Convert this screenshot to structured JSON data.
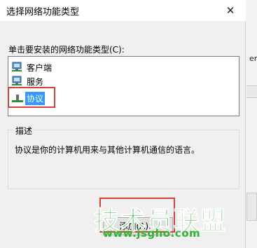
{
  "dialog": {
    "title": "选择网络功能类型",
    "close_glyph": "✕",
    "prompt": "单击要安装的网络功能类型(C):",
    "items": [
      {
        "label": "客户端",
        "icon": "network-client-icon"
      },
      {
        "label": "服务",
        "icon": "network-service-icon"
      },
      {
        "label": "协议",
        "icon": "network-protocol-icon",
        "selected": true
      }
    ],
    "description_group_title": "描述",
    "description": "协议是你的计算机用来与其他计算机通信的语言。",
    "add_button": "添加(A)..."
  },
  "background_window": {
    "partial_text": "erm"
  },
  "watermark": {
    "title": "技术员联盟",
    "url": "www.jsgho.com"
  }
}
